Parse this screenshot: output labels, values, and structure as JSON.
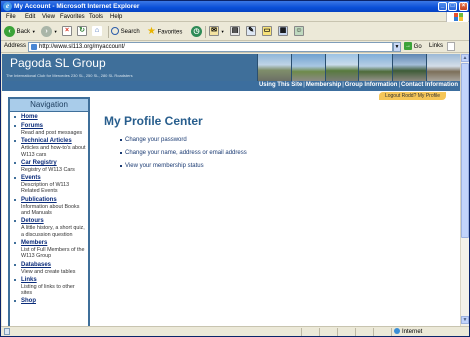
{
  "window": {
    "title": "My Account - Microsoft Internet Explorer"
  },
  "menubar": {
    "items": [
      "File",
      "Edit",
      "View",
      "Favorites",
      "Tools",
      "Help"
    ]
  },
  "toolbar": {
    "back_label": "Back",
    "search_label": "Search",
    "favorites_label": "Favorites"
  },
  "addressbar": {
    "label": "Address",
    "url": "http://www.sl113.org/myaccount/",
    "go_label": "Go",
    "links_label": "Links"
  },
  "site": {
    "logo": "Pagoda SL Group",
    "tagline": "The International Club for Mercedes 230 SL, 250 SL, 280 SL Roadsters",
    "top_nav": [
      "Using This Site",
      "Membership",
      "Group Information",
      "Contact Information"
    ],
    "logout_text": "Logout Rodd?  My Profile"
  },
  "leftnav": {
    "heading": "Navigation",
    "items": [
      {
        "label": "Home",
        "desc": ""
      },
      {
        "label": "Forums",
        "desc": "Read and post messages"
      },
      {
        "label": "Technical Articles",
        "desc": "Articles and how-to's about W113 cars"
      },
      {
        "label": "Car Registry",
        "desc": "Registry of W113 Cars"
      },
      {
        "label": "Events",
        "desc": "Description of W113 Related Events"
      },
      {
        "label": "Publications",
        "desc": "Information about Books and Manuals"
      },
      {
        "label": "Detours",
        "desc": "A little history, a short quiz, a discussion question"
      },
      {
        "label": "Members",
        "desc": "List of Full Members of the W113 Group"
      },
      {
        "label": "Databases",
        "desc": "View and create tables"
      },
      {
        "label": "Links",
        "desc": "Listing of links to other sites"
      },
      {
        "label": "Shop",
        "desc": ""
      }
    ]
  },
  "main": {
    "title": "My Profile Center",
    "links": [
      "Change your password",
      "Change your name, address or email address",
      "View your membership status"
    ]
  },
  "statusbar": {
    "zone": "Internet"
  },
  "colors": {
    "header_blue": "#3F6F9A",
    "nav_head": "#A9CCEA",
    "title_blue": "#285E8D",
    "logout_tab": "#F5C659"
  }
}
